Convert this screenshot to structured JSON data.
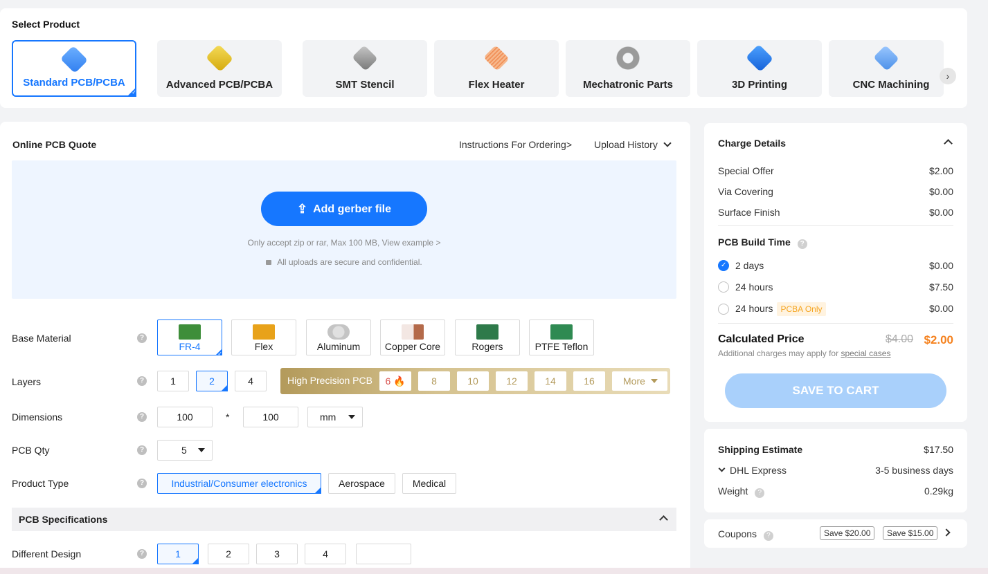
{
  "product_section": {
    "title": "Select Product",
    "products": [
      {
        "label": "Standard PCB/PCBA",
        "icon": "pcb-icon",
        "color": "#2f8bff"
      },
      {
        "label": "Advanced PCB/PCBA",
        "icon": "advanced-pcb-icon",
        "color": "#e6c21c"
      },
      {
        "label": "SMT Stencil",
        "icon": "stencil-icon",
        "color": "#8a8a8a"
      },
      {
        "label": "Flex Heater",
        "icon": "flex-heater-icon",
        "color": "#f2a36b"
      },
      {
        "label": "Mechatronic Parts",
        "icon": "nut-icon",
        "color": "#9a9a9a"
      },
      {
        "label": "3D Printing",
        "icon": "3d-printing-icon",
        "color": "#1e7bf0"
      },
      {
        "label": "CNC Machining",
        "icon": "cnc-icon",
        "color": "#5aa0f0"
      }
    ],
    "active_index": 0
  },
  "quote": {
    "title": "Online PCB Quote",
    "instructions_link": "Instructions For Ordering>",
    "upload_history": "Upload History",
    "upload_button": "Add gerber file",
    "upload_note": "Only accept zip or rar, Max 100 MB, View example >",
    "secure_note": "All uploads are secure and confidential."
  },
  "base_material": {
    "label": "Base Material",
    "options": [
      "FR-4",
      "Flex",
      "Aluminum",
      "Copper Core",
      "Rogers",
      "PTFE Teflon"
    ],
    "selected": "FR-4"
  },
  "layers": {
    "label": "Layers",
    "options": [
      "1",
      "2",
      "4"
    ],
    "selected": "2",
    "high_precision_label": "High Precision PCB",
    "high_precision_options": [
      "6",
      "8",
      "10",
      "12",
      "14",
      "16"
    ],
    "more_label": "More"
  },
  "dimensions": {
    "label": "Dimensions",
    "width": "100",
    "separator": "*",
    "height": "100",
    "unit": "mm"
  },
  "pcb_qty": {
    "label": "PCB Qty",
    "value": "5"
  },
  "product_type": {
    "label": "Product Type",
    "options": [
      "Industrial/Consumer electronics",
      "Aerospace",
      "Medical"
    ],
    "selected": "Industrial/Consumer electronics"
  },
  "specs": {
    "title": "PCB Specifications"
  },
  "different_design": {
    "label": "Different Design",
    "options": [
      "1",
      "2",
      "3",
      "4"
    ],
    "selected": "1",
    "custom_value": ""
  },
  "charge": {
    "title": "Charge Details",
    "items": [
      {
        "label": "Special Offer",
        "value": "$2.00"
      },
      {
        "label": "Via Covering",
        "value": "$0.00"
      },
      {
        "label": "Surface Finish",
        "value": "$0.00"
      }
    ],
    "build_time_title": "PCB Build Time",
    "build_options": [
      {
        "label": "2 days",
        "value": "$0.00",
        "badge": ""
      },
      {
        "label": "24 hours",
        "value": "$7.50",
        "badge": ""
      },
      {
        "label": "24 hours",
        "value": "$0.00",
        "badge": "PCBA Only"
      }
    ],
    "build_selected": 0,
    "calculated_label": "Calculated Price",
    "old_price": "$4.00",
    "new_price": "$2.00",
    "additional_note": "Additional charges may apply for",
    "special_cases": "special cases",
    "save_button": "SAVE TO CART"
  },
  "shipping": {
    "title": "Shipping Estimate",
    "price": "$17.50",
    "carrier": "DHL Express",
    "duration": "3-5 business days",
    "weight_label": "Weight",
    "weight_value": "0.29kg"
  },
  "coupons": {
    "label": "Coupons",
    "tags": [
      "Save $20.00",
      "Save $15.00"
    ]
  },
  "colors": {
    "accent": "#1677ff",
    "price_orange": "#f5821f",
    "gold": "#b39a5b"
  }
}
